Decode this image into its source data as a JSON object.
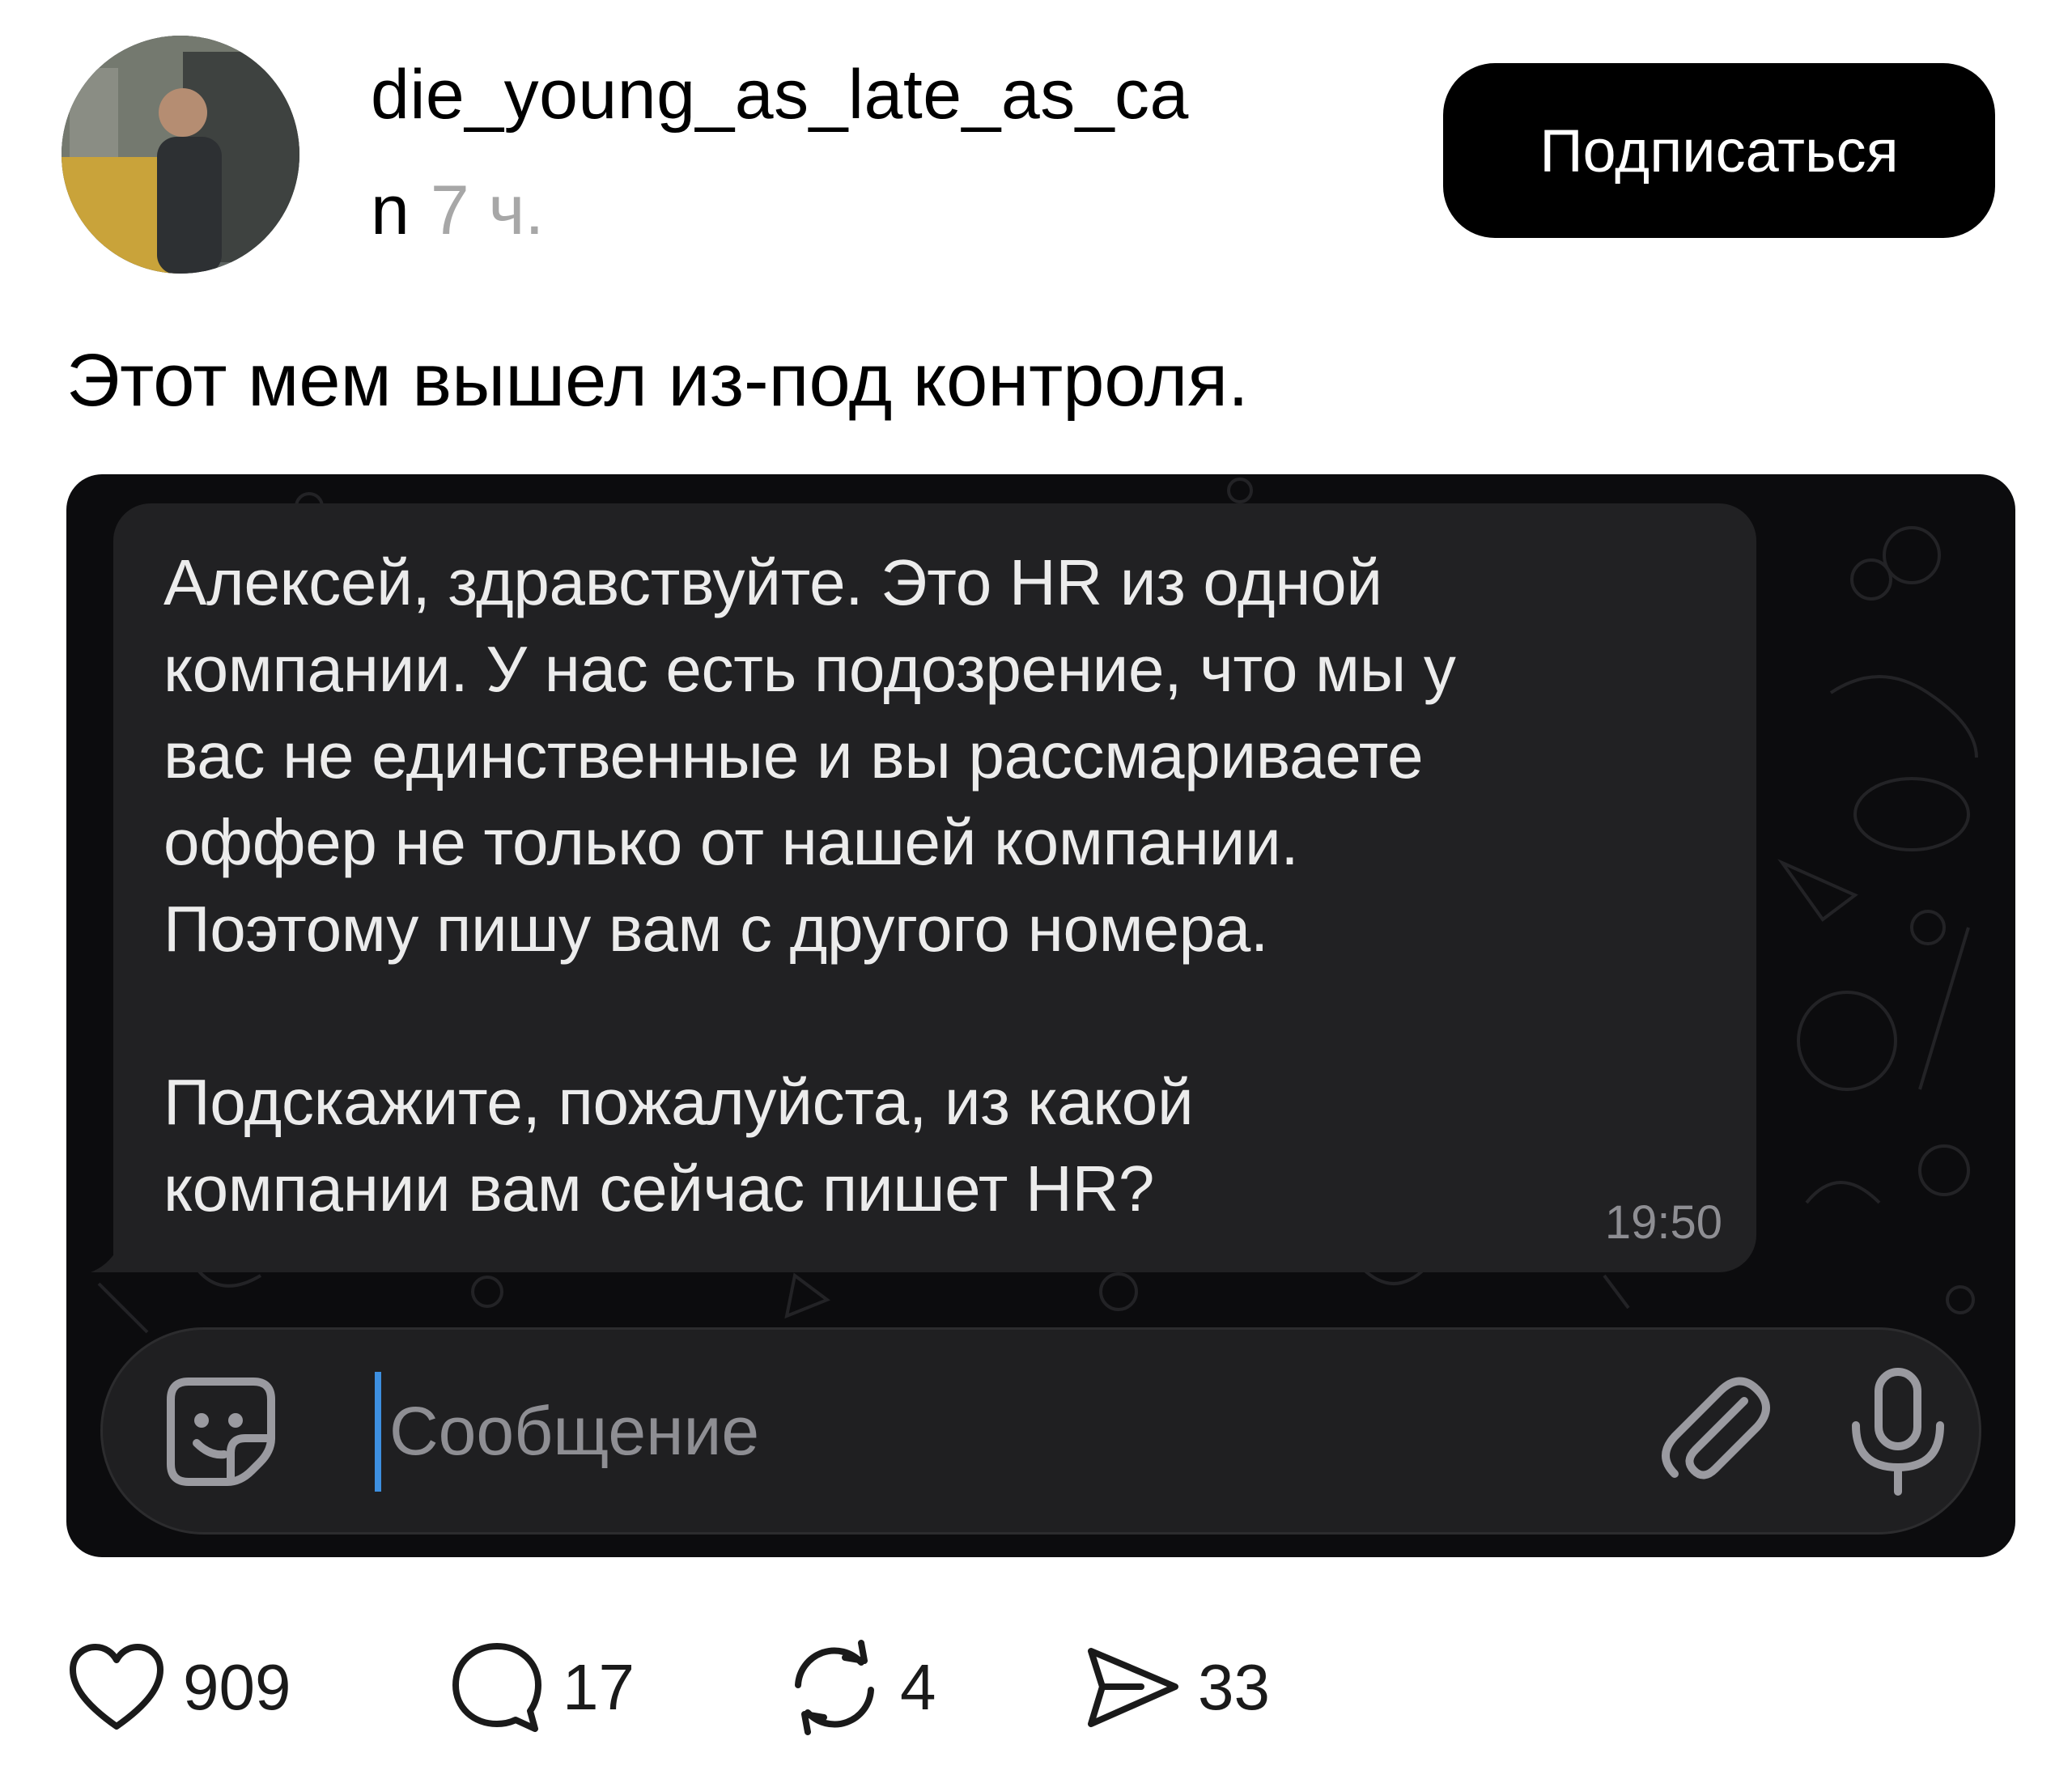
{
  "header": {
    "username_line1": "die_young_as_late_as_ca",
    "username_line2": "n",
    "time": "7 ч.",
    "follow_label": "Подписаться"
  },
  "caption": "Этот мем вышел из-под контроля.",
  "chat": {
    "message": "Алексей, здравствуйте. Это HR из одной\nкомпании. У нас есть подозрение, что мы у\nвас не единственные и вы рассмариваете\nоффер не только от нашей компании.\nПоэтому пишу вам с другого номера.\n\nПодскажите, пожалуйста, из какой\nкомпании вам сейчас пишет HR?",
    "time": "19:50",
    "input_placeholder": "Сообщение"
  },
  "actions": {
    "likes": "909",
    "comments": "17",
    "reposts": "4",
    "shares": "33"
  },
  "colors": {
    "follow_button_bg": "#000000",
    "chat_bg": "#0c0c0e",
    "bubble_bg": "#212123",
    "cursor": "#3d8fe0"
  },
  "icons": [
    "sticker-icon",
    "paperclip-icon",
    "microphone-icon",
    "heart-icon",
    "comment-icon",
    "repost-icon",
    "share-icon"
  ]
}
